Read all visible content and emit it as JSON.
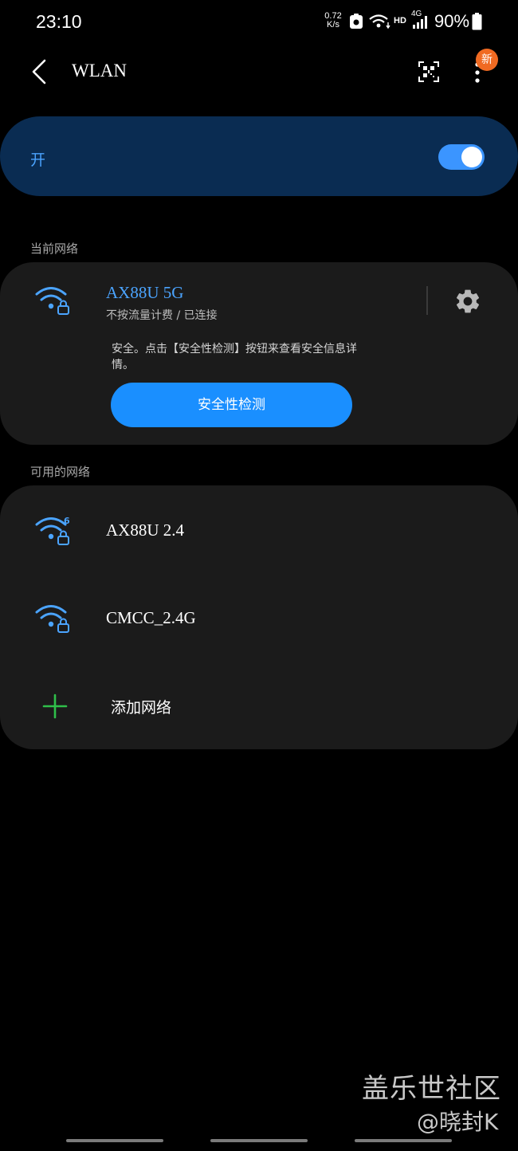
{
  "status_bar": {
    "time": "23:10",
    "net_speed_value": "0.72",
    "net_speed_unit": "K/s",
    "hd_label": "HD",
    "signal_label": "4G",
    "battery_percent": "90%"
  },
  "header": {
    "title": "WLAN",
    "menu_badge": "新"
  },
  "toggle": {
    "label": "开",
    "on": true
  },
  "current_section_title": "当前网络",
  "current_network": {
    "ssid": "AX88U 5G",
    "status": "不按流量计费 / 已连接",
    "security_message": "安全。点击【安全性检测】按钮来查看安全信息详情。",
    "check_button_label": "安全性检测"
  },
  "available_section_title": "可用的网络",
  "available_networks": [
    {
      "ssid": "AX88U 2.4",
      "wifi6": true,
      "secured": true
    },
    {
      "ssid": "CMCC_2.4G",
      "wifi6": false,
      "secured": true
    }
  ],
  "add_network_label": "添加网络",
  "watermark": {
    "line1": "盖乐世社区",
    "line2": "@晓封K"
  },
  "colors": {
    "accent": "#3b95ff",
    "toggle_card_bg": "#0a2c52",
    "card_bg": "#1b1b1b",
    "badge": "#f06a22",
    "add_icon": "#2fbf4a"
  }
}
